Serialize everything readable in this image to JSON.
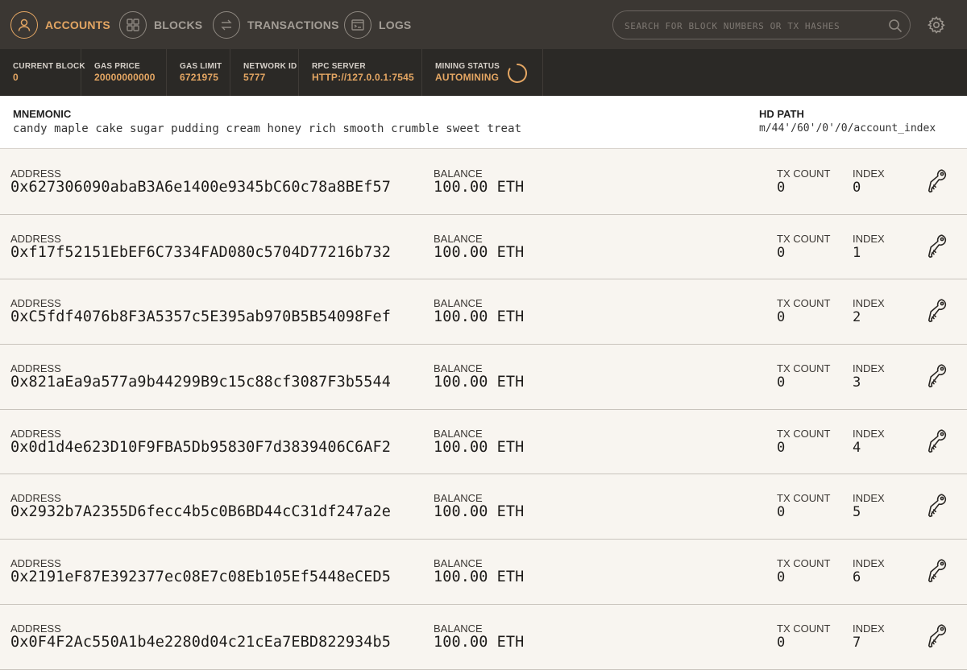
{
  "nav": {
    "accounts": "ACCOUNTS",
    "blocks": "BLOCKS",
    "transactions": "TRANSACTIONS",
    "logs": "LOGS"
  },
  "search": {
    "placeholder": "SEARCH FOR BLOCK NUMBERS OR TX HASHES"
  },
  "status": {
    "current_block_label": "CURRENT BLOCK",
    "current_block": "0",
    "gas_price_label": "GAS PRICE",
    "gas_price": "20000000000",
    "gas_limit_label": "GAS LIMIT",
    "gas_limit": "6721975",
    "network_id_label": "NETWORK ID",
    "network_id": "5777",
    "rpc_label": "RPC SERVER",
    "rpc": "HTTP://127.0.0.1:7545",
    "mining_label": "MINING STATUS",
    "mining": "AUTOMINING"
  },
  "mnemonic": {
    "title": "MNEMONIC",
    "value": "candy maple cake sugar pudding cream honey rich smooth crumble sweet treat",
    "hd_title": "HD PATH",
    "hd_value": "m/44'/60'/0'/0/account_index"
  },
  "labels": {
    "address": "ADDRESS",
    "balance": "BALANCE",
    "tx_count": "TX COUNT",
    "index": "INDEX"
  },
  "accounts": [
    {
      "address": "0x627306090abaB3A6e1400e9345bC60c78a8BEf57",
      "balance": "100.00 ETH",
      "tx_count": "0",
      "index": "0"
    },
    {
      "address": "0xf17f52151EbEF6C7334FAD080c5704D77216b732",
      "balance": "100.00 ETH",
      "tx_count": "0",
      "index": "1"
    },
    {
      "address": "0xC5fdf4076b8F3A5357c5E395ab970B5B54098Fef",
      "balance": "100.00 ETH",
      "tx_count": "0",
      "index": "2"
    },
    {
      "address": "0x821aEa9a577a9b44299B9c15c88cf3087F3b5544",
      "balance": "100.00 ETH",
      "tx_count": "0",
      "index": "3"
    },
    {
      "address": "0x0d1d4e623D10F9FBA5Db95830F7d3839406C6AF2",
      "balance": "100.00 ETH",
      "tx_count": "0",
      "index": "4"
    },
    {
      "address": "0x2932b7A2355D6fecc4b5c0B6BD44cC31df247a2e",
      "balance": "100.00 ETH",
      "tx_count": "0",
      "index": "5"
    },
    {
      "address": "0x2191eF87E392377ec08E7c08Eb105Ef5448eCED5",
      "balance": "100.00 ETH",
      "tx_count": "0",
      "index": "6"
    },
    {
      "address": "0x0F4F2Ac550A1b4e2280d04c21cEa7EBD822934b5",
      "balance": "100.00 ETH",
      "tx_count": "0",
      "index": "7"
    }
  ],
  "colors": {
    "accent": "#e4a663",
    "nav_bg": "#3b3733",
    "status_bg": "#2b2926",
    "page_bg": "#f8f5f0"
  },
  "icons": {
    "accounts": "user-icon",
    "blocks": "grid-icon",
    "transactions": "swap-arrows-icon",
    "logs": "terminal-icon",
    "search": "search-icon",
    "settings": "gear-icon",
    "account_key": "key-icon",
    "mining": "spinner-icon"
  }
}
